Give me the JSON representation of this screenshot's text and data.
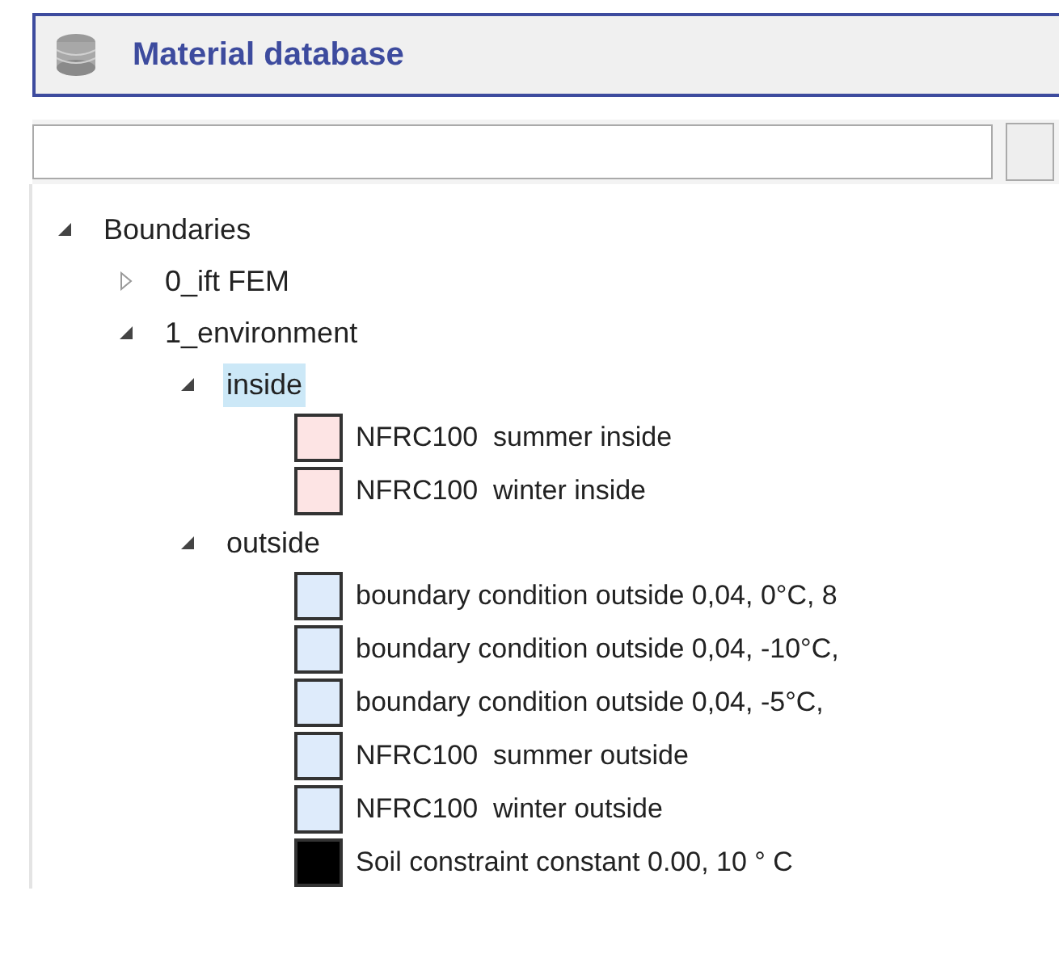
{
  "panel": {
    "title": "Material database"
  },
  "tree": [
    {
      "label": "Boundaries",
      "expanded": true,
      "selected": false,
      "children": [
        {
          "label": "0_ift FEM",
          "expanded": false,
          "selected": false
        },
        {
          "label": "1_environment",
          "expanded": true,
          "selected": false,
          "children": [
            {
              "label": "inside",
              "expanded": true,
              "selected": true,
              "children": [
                {
                  "label": "NFRC100  summer inside",
                  "color": "#fde4e4"
                },
                {
                  "label": "NFRC100  winter inside",
                  "color": "#fde4e4"
                }
              ]
            },
            {
              "label": "outside",
              "expanded": true,
              "selected": false,
              "children": [
                {
                  "label": "boundary condition outside 0,04, 0°C, 8",
                  "color": "#deebfb"
                },
                {
                  "label": "boundary condition outside 0,04, -10°C,",
                  "color": "#deebfb"
                },
                {
                  "label": "boundary condition outside 0,04, -5°C,",
                  "color": "#deebfb"
                },
                {
                  "label": "NFRC100  summer outside",
                  "color": "#deebfb"
                },
                {
                  "label": "NFRC100  winter outside",
                  "color": "#deebfb"
                },
                {
                  "label": "Soil constraint constant 0.00, 10 ° C",
                  "color": "#000000"
                }
              ]
            }
          ]
        }
      ]
    }
  ]
}
